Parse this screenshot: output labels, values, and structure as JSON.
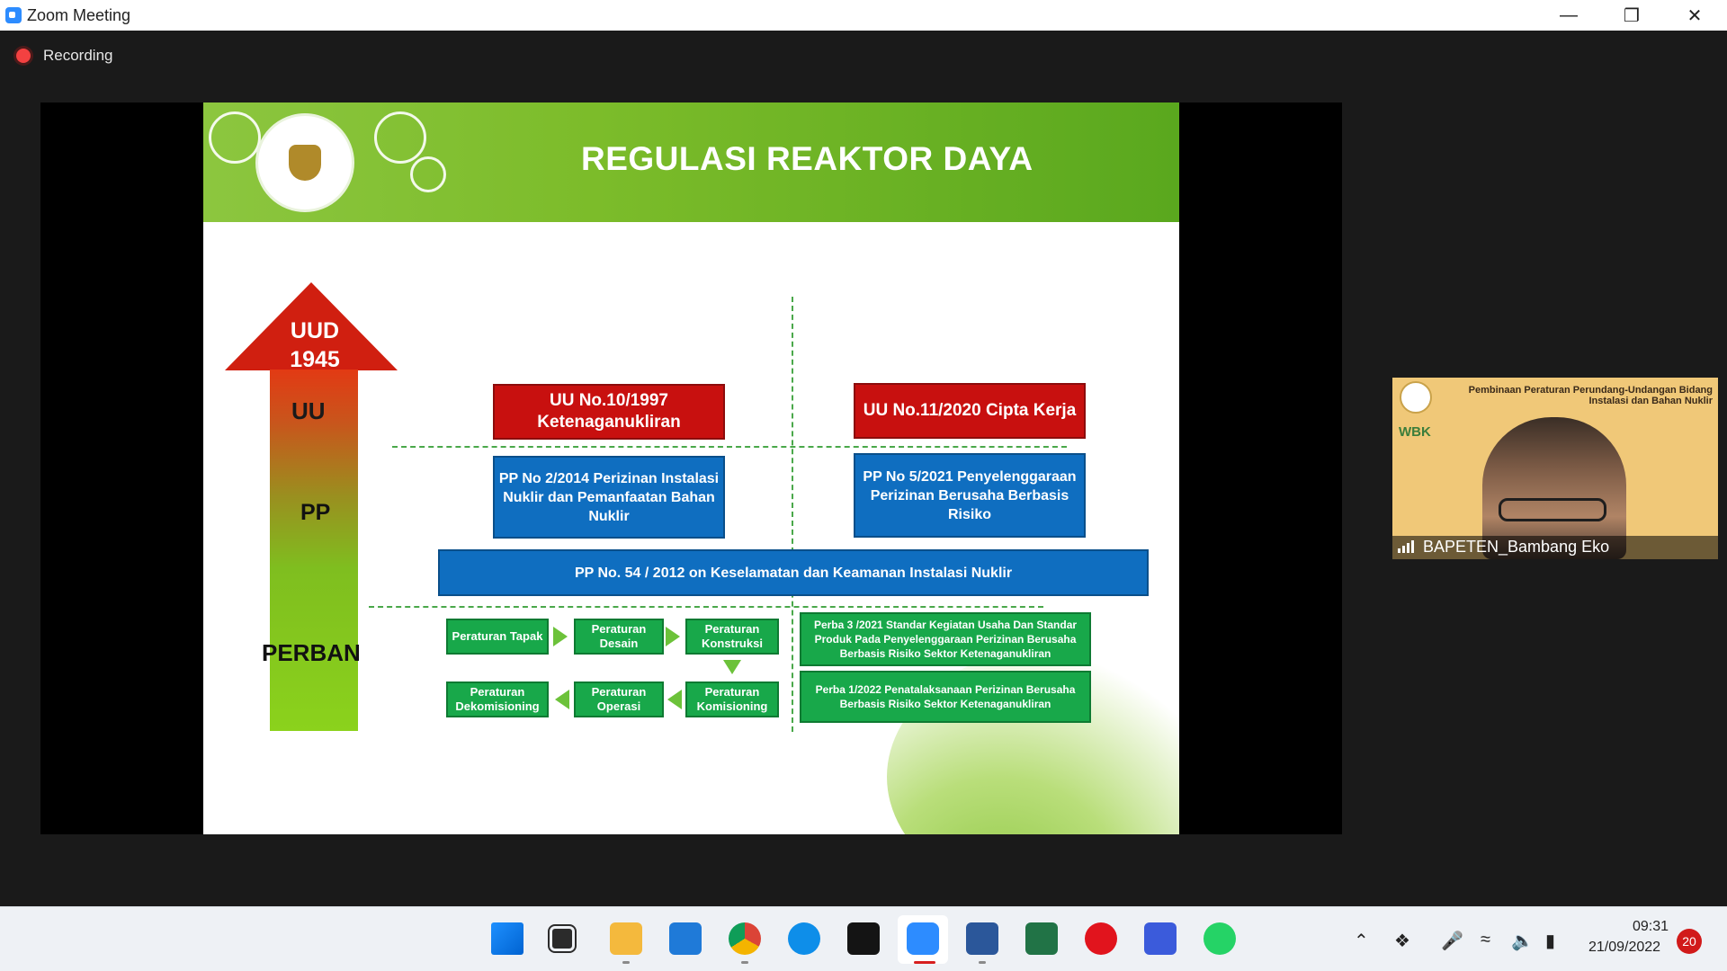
{
  "window": {
    "title": "Zoom Meeting",
    "min_icon": "—",
    "max_icon": "❐",
    "close_icon": "✕"
  },
  "recording": {
    "label": "Recording"
  },
  "slide": {
    "title": "REGULASI REAKTOR DAYA",
    "hierarchy": {
      "uud": "UUD 1945",
      "uu": "UU",
      "pp": "PP",
      "perban": "PERBAN"
    },
    "uu_left": "UU No.10/1997 Ketenaganukliran",
    "uu_right": "UU No.11/2020 Cipta Kerja",
    "pp_left": "PP No 2/2014 Perizinan Instalasi Nuklir dan Pemanfaatan Bahan Nuklir",
    "pp_right": "PP No 5/2021 Penyelenggaraan Perizinan Berusaha Berbasis Risiko",
    "pp_shared": "PP No. 54 / 2012 on Keselamatan dan Keamanan Instalasi Nuklir",
    "perban_steps": {
      "tapak": "Peraturan Tapak",
      "desain": "Peraturan Desain",
      "konstruksi": "Peraturan Konstruksi",
      "komisioning": "Peraturan Komisioning",
      "operasi": "Peraturan Operasi",
      "dekomisioning": "Peraturan Dekomisioning"
    },
    "perba_1": "Perba 3 /2021 Standar Kegiatan Usaha Dan Standar Produk Pada Penyelenggaraan Perizinan Berusaha Berbasis Risiko Sektor Ketenaganukliran",
    "perba_2": "Perba 1/2022 Penatalaksanaan Perizinan Berusaha Berbasis Risiko Sektor Ketenaganukliran"
  },
  "participant": {
    "heading": "Pembinaan Peraturan Perundang-Undangan Bidang Instalasi dan Bahan Nuklir",
    "badge": "WBK",
    "name": "BAPETEN_Bambang Eko"
  },
  "taskbar": {
    "apps": [
      "start-icon",
      "task-view-icon",
      "file-explorer-icon",
      "mail-icon",
      "chrome-icon",
      "teamviewer-icon",
      "webex-icon",
      "zoom-icon",
      "word-icon",
      "excel-icon",
      "opera-icon",
      "nx-icon",
      "whatsapp-icon"
    ],
    "time": "09:31",
    "date": "21/09/2022",
    "notifications": "20"
  },
  "colors": {
    "zoom_blue": "#2d8cff",
    "slide_green": "#7cbc2a",
    "box_red": "#c8100f",
    "box_blue": "#0f6ec0",
    "box_green": "#18a84a"
  }
}
